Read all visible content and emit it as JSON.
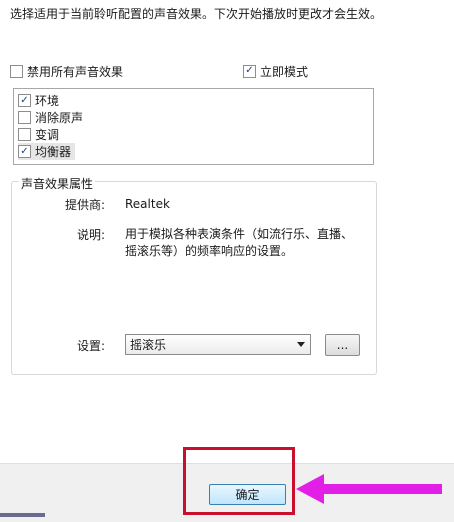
{
  "description": "选择适用于当前聆听配置的声音效果。下次开始播放时更改才会生效。",
  "disable_all": {
    "label": "禁用所有声音效果",
    "checked": false
  },
  "immediate_mode": {
    "label": "立即模式",
    "checked": true
  },
  "effects": [
    {
      "label": "环境",
      "checked": true,
      "selected": false
    },
    {
      "label": "消除原声",
      "checked": false,
      "selected": false
    },
    {
      "label": "变调",
      "checked": false,
      "selected": false
    },
    {
      "label": "均衡器",
      "checked": true,
      "selected": true
    }
  ],
  "properties": {
    "title": "声音效果属性",
    "provider_label": "提供商:",
    "provider_value": "Realtek",
    "desc_label": "说明:",
    "desc_value": "用于模拟各种表演条件（如流行乐、直播、摇滚乐等）的频率响应的设置。",
    "setting_label": "设置:",
    "setting_value": "摇滚乐",
    "more_button": "..."
  },
  "ok_button": "确定",
  "colors": {
    "annotation_red": "#c8102e",
    "arrow_magenta": "#e21fe6",
    "checkmark": "#1e3f8a"
  }
}
